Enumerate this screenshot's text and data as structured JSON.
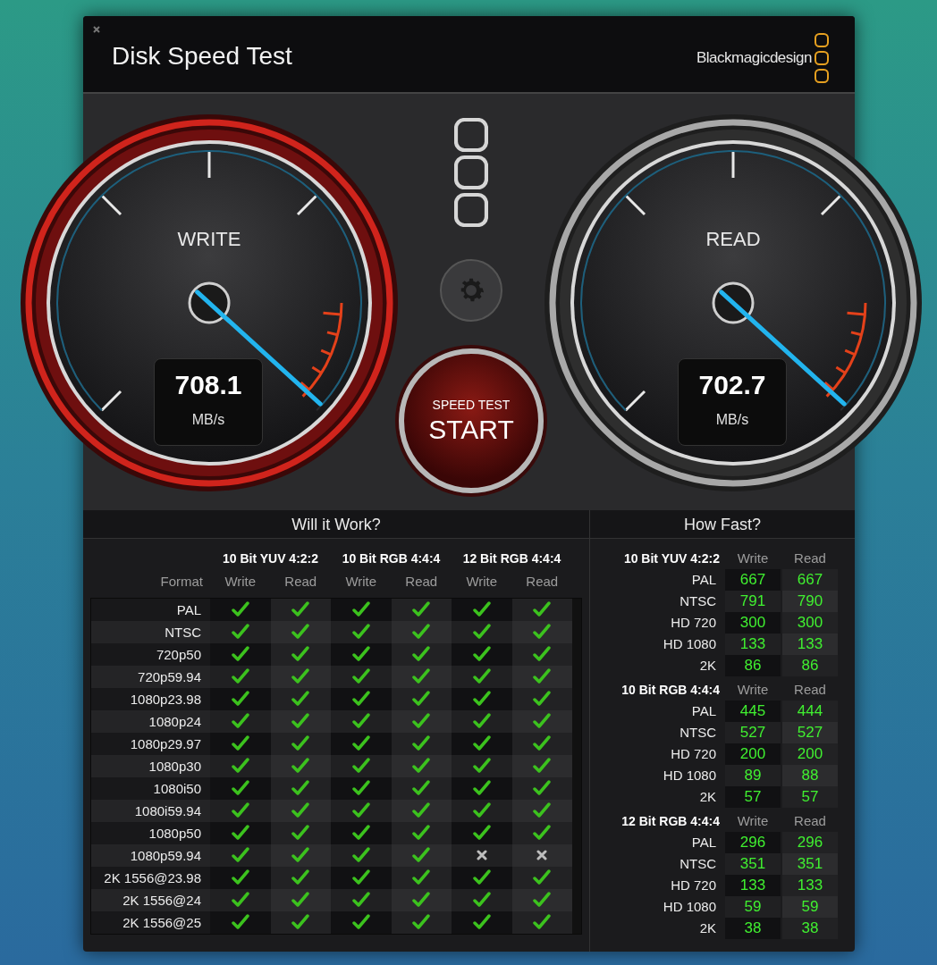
{
  "window": {
    "title": "Disk Speed Test",
    "brand": "Blackmagicdesign"
  },
  "gauges": [
    {
      "kind": "write",
      "label": "WRITE",
      "value": "708.1",
      "unit": "MB/s",
      "level": 0.99
    },
    {
      "kind": "read",
      "label": "READ",
      "value": "702.7",
      "unit": "MB/s",
      "level": 0.99
    }
  ],
  "start_button": {
    "caption": "SPEED TEST",
    "label": "START"
  },
  "will_it_work": {
    "title": "Will it Work?",
    "format_header": "Format",
    "groups": [
      {
        "name": "10 Bit YUV 4:2:2",
        "columns": [
          "Write",
          "Read"
        ]
      },
      {
        "name": "10 Bit RGB 4:4:4",
        "columns": [
          "Write",
          "Read"
        ]
      },
      {
        "name": "12 Bit RGB 4:4:4",
        "columns": [
          "Write",
          "Read"
        ]
      }
    ],
    "rows": [
      {
        "format": "PAL",
        "checks": [
          true,
          true,
          true,
          true,
          true,
          true
        ]
      },
      {
        "format": "NTSC",
        "checks": [
          true,
          true,
          true,
          true,
          true,
          true
        ]
      },
      {
        "format": "720p50",
        "checks": [
          true,
          true,
          true,
          true,
          true,
          true
        ]
      },
      {
        "format": "720p59.94",
        "checks": [
          true,
          true,
          true,
          true,
          true,
          true
        ]
      },
      {
        "format": "1080p23.98",
        "checks": [
          true,
          true,
          true,
          true,
          true,
          true
        ]
      },
      {
        "format": "1080p24",
        "checks": [
          true,
          true,
          true,
          true,
          true,
          true
        ]
      },
      {
        "format": "1080p29.97",
        "checks": [
          true,
          true,
          true,
          true,
          true,
          true
        ]
      },
      {
        "format": "1080p30",
        "checks": [
          true,
          true,
          true,
          true,
          true,
          true
        ]
      },
      {
        "format": "1080i50",
        "checks": [
          true,
          true,
          true,
          true,
          true,
          true
        ]
      },
      {
        "format": "1080i59.94",
        "checks": [
          true,
          true,
          true,
          true,
          true,
          true
        ]
      },
      {
        "format": "1080p50",
        "checks": [
          true,
          true,
          true,
          true,
          true,
          true
        ]
      },
      {
        "format": "1080p59.94",
        "checks": [
          true,
          true,
          true,
          true,
          false,
          false
        ]
      },
      {
        "format": "2K 1556@23.98",
        "checks": [
          true,
          true,
          true,
          true,
          true,
          true
        ]
      },
      {
        "format": "2K 1556@24",
        "checks": [
          true,
          true,
          true,
          true,
          true,
          true
        ]
      },
      {
        "format": "2K 1556@25",
        "checks": [
          true,
          true,
          true,
          true,
          true,
          true
        ]
      }
    ]
  },
  "how_fast": {
    "title": "How Fast?",
    "groups": [
      {
        "name": "10 Bit YUV 4:2:2",
        "columns": [
          "Write",
          "Read"
        ],
        "rows": [
          {
            "format": "PAL",
            "write": "667",
            "read": "667"
          },
          {
            "format": "NTSC",
            "write": "791",
            "read": "790"
          },
          {
            "format": "HD 720",
            "write": "300",
            "read": "300"
          },
          {
            "format": "HD 1080",
            "write": "133",
            "read": "133"
          },
          {
            "format": "2K",
            "write": "86",
            "read": "86"
          }
        ]
      },
      {
        "name": "10 Bit RGB 4:4:4",
        "columns": [
          "Write",
          "Read"
        ],
        "rows": [
          {
            "format": "PAL",
            "write": "445",
            "read": "444"
          },
          {
            "format": "NTSC",
            "write": "527",
            "read": "527"
          },
          {
            "format": "HD 720",
            "write": "200",
            "read": "200"
          },
          {
            "format": "HD 1080",
            "write": "89",
            "read": "88"
          },
          {
            "format": "2K",
            "write": "57",
            "read": "57"
          }
        ]
      },
      {
        "name": "12 Bit RGB 4:4:4",
        "columns": [
          "Write",
          "Read"
        ],
        "rows": [
          {
            "format": "PAL",
            "write": "296",
            "read": "296"
          },
          {
            "format": "NTSC",
            "write": "351",
            "read": "351"
          },
          {
            "format": "HD 720",
            "write": "133",
            "read": "133"
          },
          {
            "format": "HD 1080",
            "write": "59",
            "read": "59"
          },
          {
            "format": "2K",
            "write": "38",
            "read": "38"
          }
        ]
      }
    ]
  }
}
